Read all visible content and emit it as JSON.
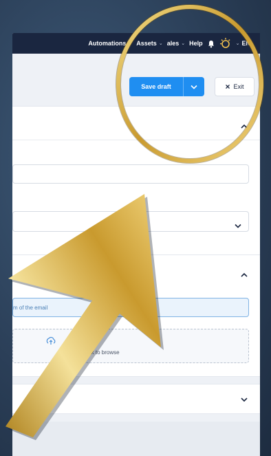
{
  "nav": {
    "items": [
      {
        "label": "Automations",
        "chevron": "⌄"
      },
      {
        "label": "Assets",
        "chevron": "⌄"
      },
      {
        "label": "ales",
        "chevron": "⌄"
      },
      {
        "label": "Help"
      }
    ],
    "bell_icon": "bell-icon",
    "status_icon": "sun-icon",
    "language": "EN",
    "language_chevron": "⌄"
  },
  "toolbar": {
    "save_label": "Save draft",
    "exit_label": "Exit",
    "exit_icon": "×"
  },
  "form": {
    "subject_value": "m of the email",
    "dropzone_text": "your files      ck to browse"
  },
  "colors": {
    "nav_bg": "#1a2640",
    "primary": "#1f8ef1",
    "ring_gold": "#d9b54a",
    "arrow_gold": "#c9a23a"
  }
}
